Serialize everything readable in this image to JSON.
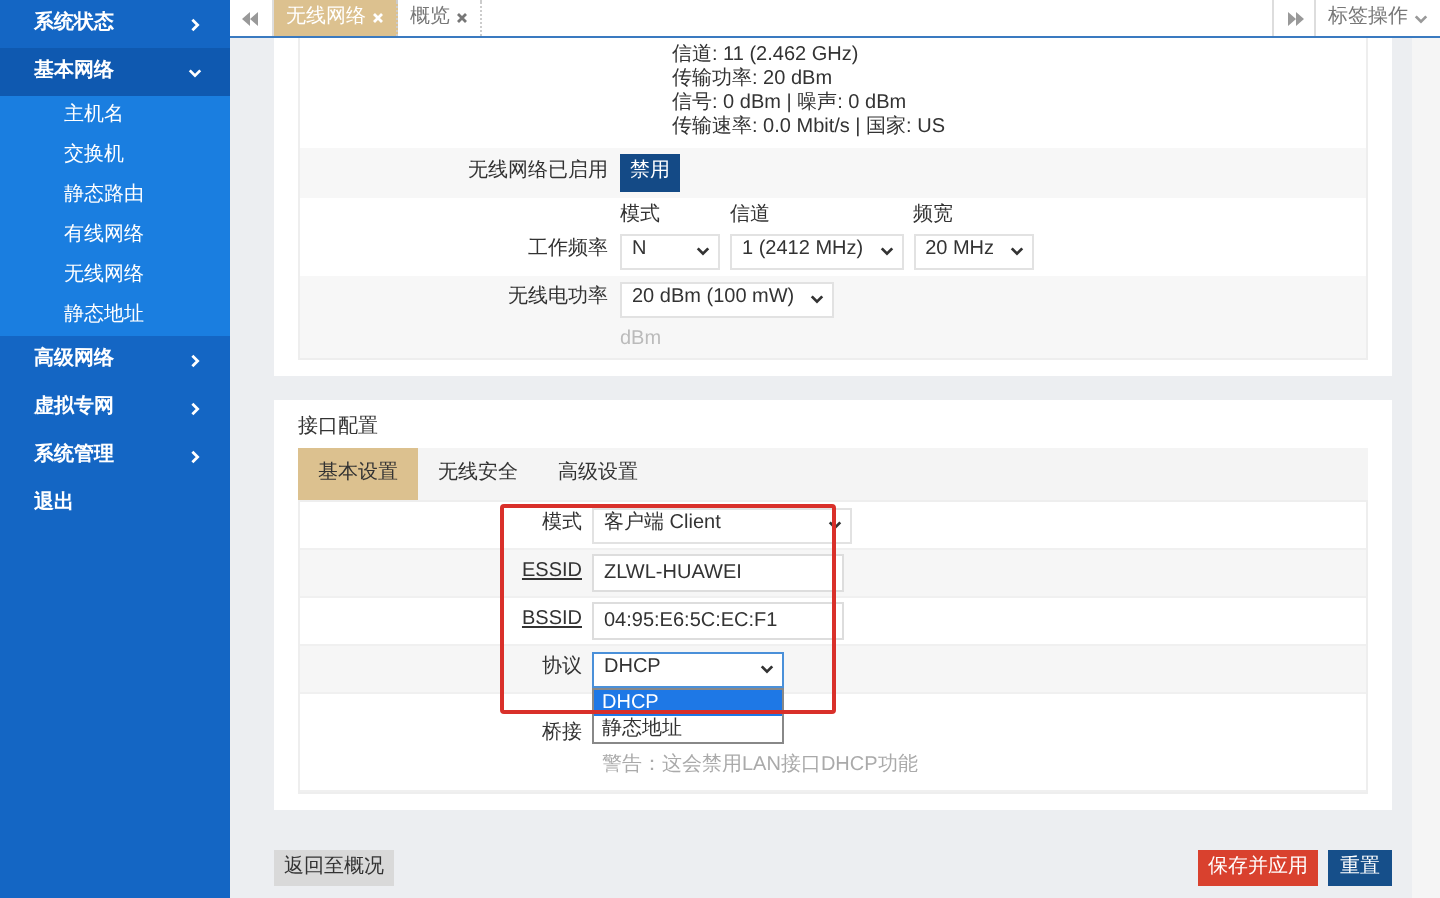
{
  "sidebar": {
    "items": [
      {
        "label": "系统状态",
        "expanded": false
      },
      {
        "label": "基本网络",
        "expanded": true,
        "children": [
          {
            "label": "主机名"
          },
          {
            "label": "交换机"
          },
          {
            "label": "静态路由"
          },
          {
            "label": "有线网络"
          },
          {
            "label": "无线网络"
          },
          {
            "label": "静态地址"
          }
        ]
      },
      {
        "label": "高级网络",
        "expanded": false
      },
      {
        "label": "虚拟专网",
        "expanded": false
      },
      {
        "label": "系统管理",
        "expanded": false
      },
      {
        "label": "退出",
        "kind": "plain"
      }
    ]
  },
  "tabs": [
    {
      "label": "无线网络",
      "selected": true
    },
    {
      "label": "概览",
      "selected": false
    }
  ],
  "tab_actions": "标签操作",
  "device_status": [
    "信道: 11 (2.462 GHz)",
    "传输功率: 20 dBm",
    "信号: 0 dBm | 噪声: 0 dBm",
    "传输速率: 0.0 Mbit/s | 国家: US"
  ],
  "wireless_enabled": {
    "label": "无线网络已启用",
    "button": "禁用"
  },
  "frequency": {
    "label": "工作频率",
    "fields": [
      {
        "caption": "模式",
        "value": "N"
      },
      {
        "caption": "信道",
        "value": "1 (2412 MHz)"
      },
      {
        "caption": "频宽",
        "value": "20 MHz"
      }
    ]
  },
  "tx_power": {
    "label": "无线电功率",
    "value": "20 dBm (100 mW)",
    "hint": "dBm"
  },
  "interface": {
    "title": "接口配置",
    "tabs": [
      {
        "label": "基本设置",
        "selected": true
      },
      {
        "label": "无线安全",
        "selected": false
      },
      {
        "label": "高级设置",
        "selected": false
      }
    ],
    "rows": [
      {
        "kind": "select",
        "label": "模式",
        "value": "客户端 Client"
      },
      {
        "kind": "input",
        "label": "ESSID",
        "value": "ZLWL-HUAWEI"
      },
      {
        "kind": "input",
        "label": "BSSID",
        "value": "04:95:E6:5C:EC:F1"
      },
      {
        "kind": "select",
        "label": "协议",
        "value": "DHCP",
        "open": true,
        "options": [
          {
            "label": "DHCP",
            "selected": true
          },
          {
            "label": "静态地址",
            "selected": false
          }
        ]
      },
      {
        "kind": "note",
        "label": "桥接",
        "note": "警告：这会禁用LAN接口DHCP功能"
      }
    ]
  },
  "buttons": {
    "back": "返回至概况",
    "save": "保存并应用",
    "reset": "重置"
  }
}
